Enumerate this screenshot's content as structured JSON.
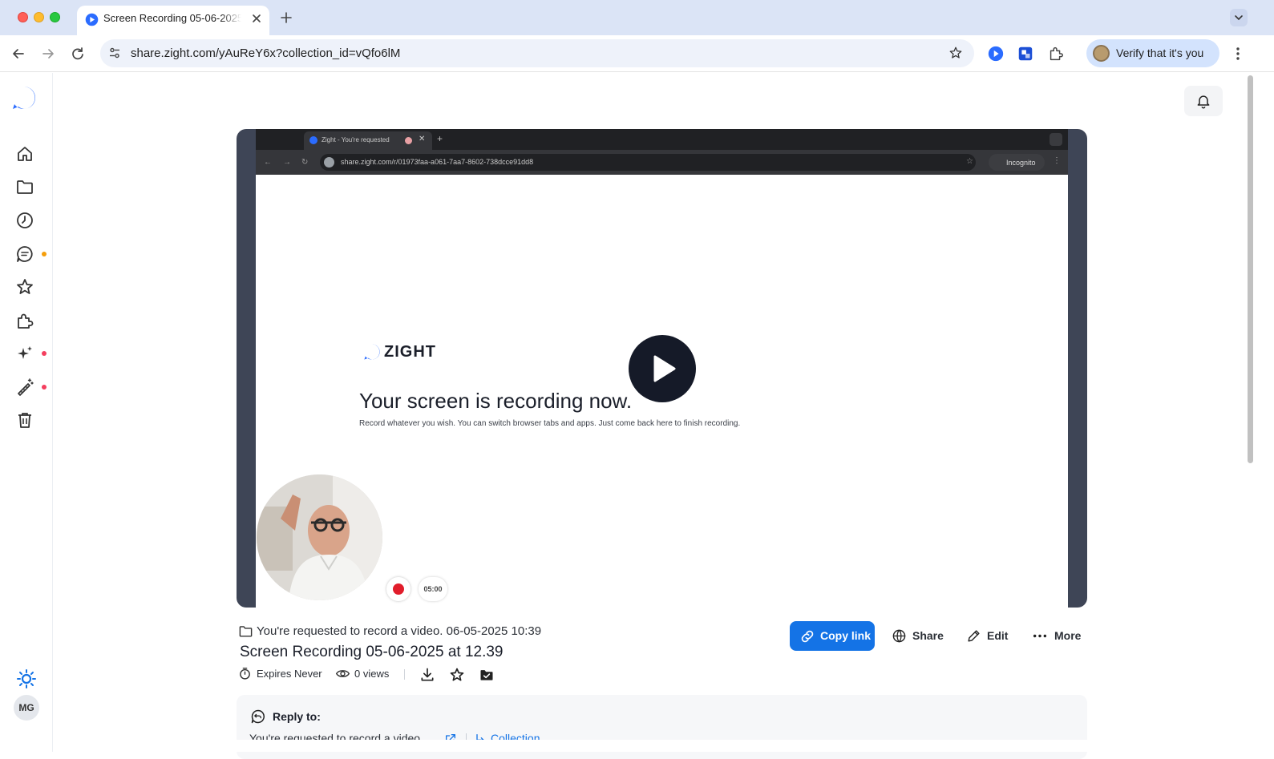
{
  "browser": {
    "tab_title": "Screen Recording 05-06-2025 at 12.39",
    "url_host": "share.zight.com",
    "url_path": "/yAuReY6x?collection_id=vQfo6lM",
    "profile_label": "Verify that it's you"
  },
  "sidebar": {
    "items": [
      {
        "name": "home",
        "icon": "home-icon"
      },
      {
        "name": "folders",
        "icon": "folder-icon"
      },
      {
        "name": "recent",
        "icon": "clock-icon"
      },
      {
        "name": "comments",
        "icon": "chat-icon",
        "badge_color": "#f59e0b"
      },
      {
        "name": "favorites",
        "icon": "star-icon"
      },
      {
        "name": "integrations",
        "icon": "puzzle-icon"
      },
      {
        "name": "ai",
        "icon": "sparkles-icon",
        "badge_color": "#f43f5e"
      },
      {
        "name": "tools",
        "icon": "wand-icon",
        "badge_color": "#f43f5e"
      },
      {
        "name": "trash",
        "icon": "trash-icon"
      }
    ],
    "user_initials": "MG"
  },
  "video": {
    "frame_tab_title": "Zight - You're requested",
    "frame_url": "share.zight.com/r/01973faa-a061-7aa7-8602-738dcce91dd8",
    "frame_incognito": "Incognito",
    "brand": "ZIGHT",
    "headline": "Your screen is recording now.",
    "subtext": "Record whatever you wish. You can switch browser tabs and apps. Just come back here to finish recording.",
    "timer": "05:00"
  },
  "meta": {
    "folder_text": "You're requested to record a video. 06-05-2025 10:39",
    "title": "Screen Recording 05-06-2025 at 12.39",
    "expires": "Expires Never",
    "views": "0 views"
  },
  "actions": {
    "copy_link": "Copy link",
    "share": "Share",
    "edit": "Edit",
    "more": "More"
  },
  "reply": {
    "title": "Reply to:",
    "item": "You're requested to record a video",
    "collection": "Collection"
  },
  "colors": {
    "accent": "#1473e6",
    "player_bg": "#3e4556",
    "brand_blue": "#2b6cff"
  }
}
